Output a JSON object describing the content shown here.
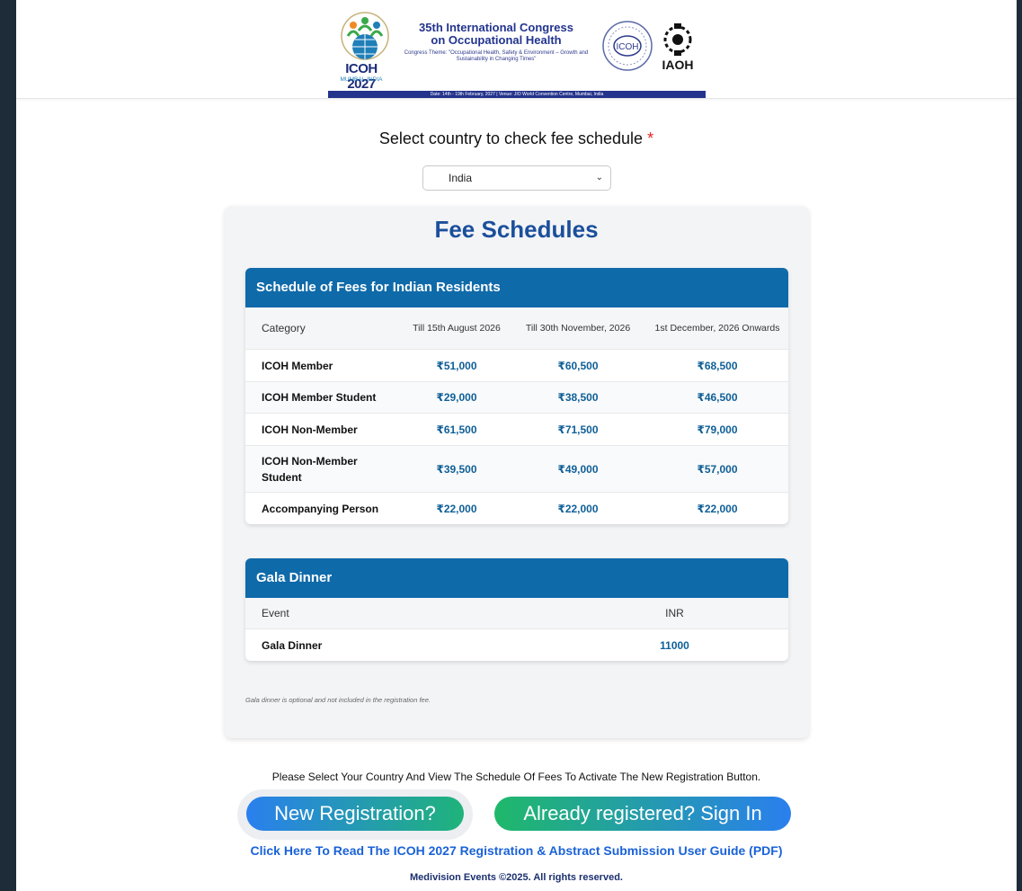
{
  "banner": {
    "logo_year": "ICOH 2027",
    "logo_city": "MUMBAI, INDIA",
    "title_line1": "35th International Congress",
    "title_line2": "on Occupational Health",
    "theme": "Congress Theme: \"Occupational Health, Safety & Environment – Growth and Sustainability in Changing Times\"",
    "seal_text": "ICOH",
    "iaoh_text": "IAOH",
    "strip_text": "Date: 14th - 19th February, 2027 | Venue: JIO World Convention Centre, Mumbai, India"
  },
  "country_select": {
    "label": "Select country to check fee schedule",
    "required_mark": "*",
    "selected": "India"
  },
  "fee": {
    "title": "Fee Schedules",
    "residents_table": {
      "heading": "Schedule of Fees for Indian Residents",
      "columns": [
        "Category",
        "Till 15th August 2026",
        "Till 30th November, 2026",
        "1st December, 2026 Onwards"
      ],
      "rows": [
        {
          "category": "ICOH Member",
          "p1": "₹51,000",
          "p2": "₹60,500",
          "p3": "₹68,500"
        },
        {
          "category": "ICOH Member Student",
          "p1": "₹29,000",
          "p2": "₹38,500",
          "p3": "₹46,500"
        },
        {
          "category": "ICOH Non-Member",
          "p1": "₹61,500",
          "p2": "₹71,500",
          "p3": "₹79,000"
        },
        {
          "category": "ICOH Non-Member Student",
          "p1": "₹39,500",
          "p2": "₹49,000",
          "p3": "₹57,000"
        },
        {
          "category": "Accompanying Person",
          "p1": "₹22,000",
          "p2": "₹22,000",
          "p3": "₹22,000"
        }
      ]
    },
    "gala_table": {
      "heading": "Gala Dinner",
      "columns": [
        "Event",
        "INR"
      ],
      "rows": [
        {
          "event": "Gala Dinner",
          "inr": "11000"
        }
      ]
    },
    "note": "Gala dinner is optional and not included in the registration fee."
  },
  "info_text": "Please Select Your Country And View The Schedule Of Fees To Activate The New Registration Button.",
  "buttons": {
    "new_registration": "New Registration?",
    "sign_in": "Already registered? Sign In"
  },
  "guide_link": "Click Here To Read The ICOH 2027 Registration & Abstract Submission User Guide (PDF)",
  "footer": "Medivision Events ©2025. All rights reserved.",
  "colors": {
    "brand_blue": "#0f6aa9",
    "title_blue": "#1b4f9c",
    "link_blue": "#1a62d8",
    "green": "#1fb86a"
  }
}
